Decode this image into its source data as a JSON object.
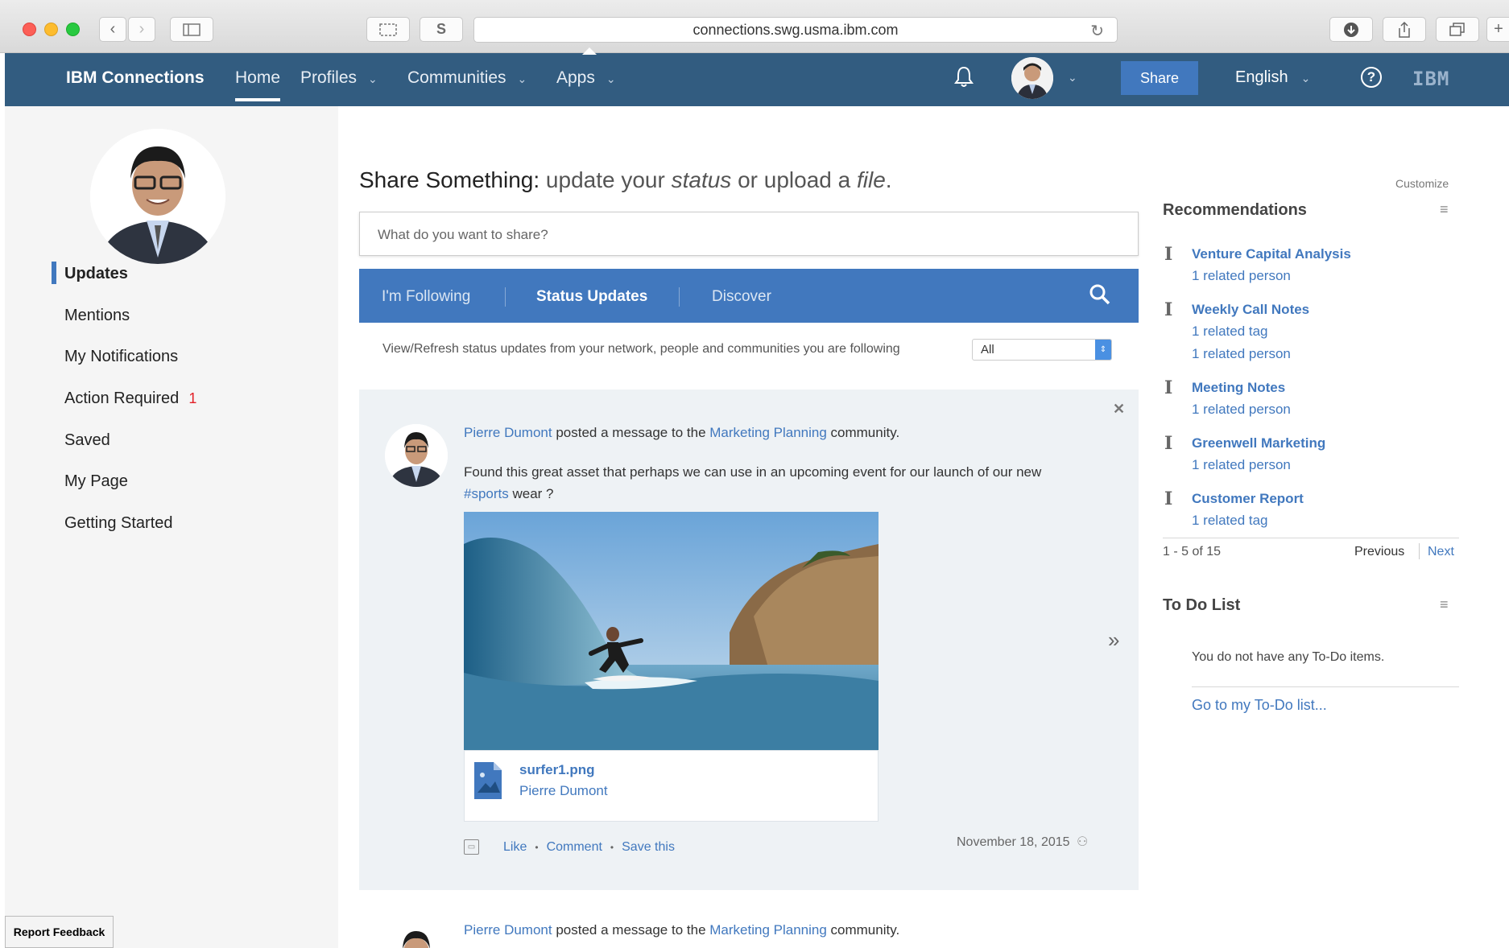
{
  "browser": {
    "url": "connections.swg.usma.ibm.com"
  },
  "header": {
    "brand": "IBM Connections",
    "nav": [
      {
        "label": "Home"
      },
      {
        "label": "Profiles"
      },
      {
        "label": "Communities"
      },
      {
        "label": "Apps"
      }
    ],
    "share_label": "Share",
    "language": "English",
    "help_label": "?",
    "logo_text": "IBM",
    "accent": "#325c80"
  },
  "sidebar": {
    "items": [
      {
        "label": "Updates"
      },
      {
        "label": "Mentions"
      },
      {
        "label": "My Notifications"
      },
      {
        "label": "Action Required",
        "badge": "1"
      },
      {
        "label": "Saved"
      },
      {
        "label": "My Page"
      },
      {
        "label": "Getting Started"
      }
    ],
    "feedback_label": "Report Feedback"
  },
  "main": {
    "share_prefix": "Share Something:",
    "share_mid1": "update your",
    "share_status": "status",
    "share_mid2": "or upload a",
    "share_file": "file",
    "share_end": ".",
    "share_placeholder": "What do you want to share?",
    "tabs": [
      {
        "label": "I'm Following"
      },
      {
        "label": "Status Updates"
      },
      {
        "label": "Discover"
      }
    ],
    "filter_text": "View/Refresh status updates from your network, people and communities you are following",
    "filter_value": "All",
    "posts": [
      {
        "author": "Pierre Dumont",
        "action_1": "posted a message to the",
        "community": "Marketing Planning",
        "action_2": "community.",
        "body_1": "Found this great asset that perhaps we can use in an upcoming event for our launch of our new",
        "hashtag": "#sports",
        "body_2": "wear ?",
        "file_name": "surfer1.png",
        "file_author": "Pierre Dumont",
        "like": "Like",
        "comment": "Comment",
        "save": "Save this",
        "date": "November 18, 2015"
      },
      {
        "author": "Pierre Dumont",
        "action_1": "posted a message to the",
        "community": "Marketing Planning",
        "action_2": "community."
      }
    ]
  },
  "right": {
    "customize": "Customize",
    "recommendations": {
      "title": "Recommendations",
      "items": [
        {
          "title": "Venture Capital Analysis",
          "subs": [
            "1 related person"
          ]
        },
        {
          "title": "Weekly Call Notes",
          "subs": [
            "1 related tag",
            "1 related person"
          ]
        },
        {
          "title": "Meeting Notes",
          "subs": [
            "1 related person"
          ]
        },
        {
          "title": "Greenwell Marketing",
          "subs": [
            "1 related person"
          ]
        },
        {
          "title": "Customer Report",
          "subs": [
            "1 related tag"
          ]
        }
      ],
      "pager_count": "1 - 5 of 15",
      "previous": "Previous",
      "next": "Next"
    },
    "todo": {
      "title": "To Do List",
      "empty": "You do not have any To-Do items.",
      "link": "Go to my To-Do list..."
    }
  }
}
